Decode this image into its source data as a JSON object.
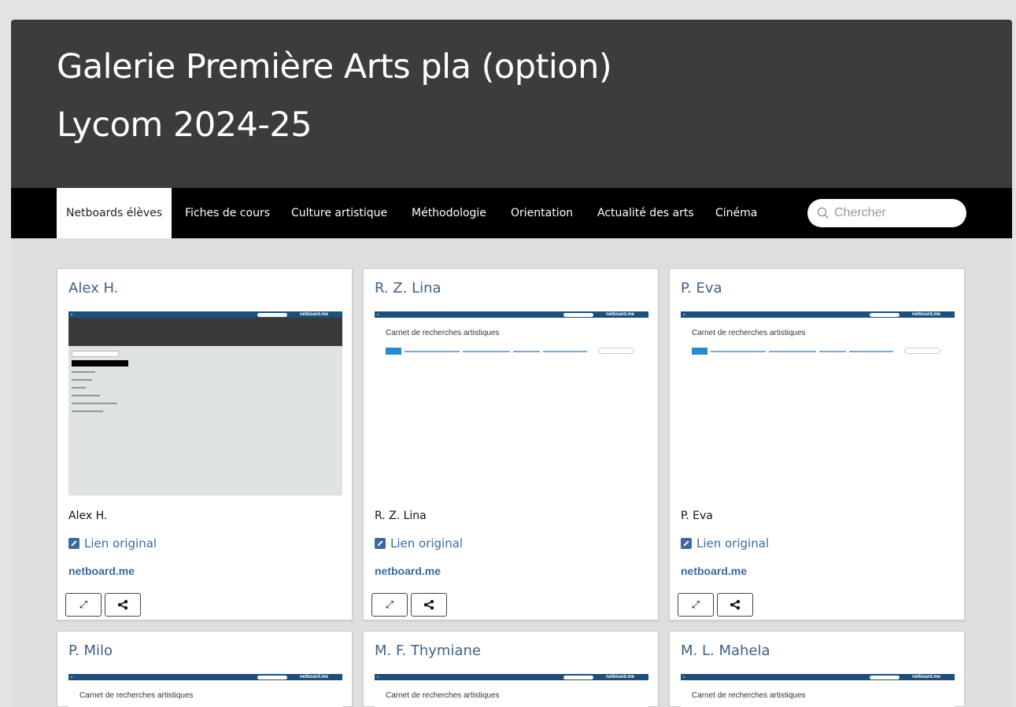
{
  "header": {
    "title_line1": "Galerie Première Arts pla (option)",
    "title_line2": "Lycom 2024-25"
  },
  "nav": {
    "items": [
      {
        "label": "Netboards élèves",
        "active": true
      },
      {
        "label": "Fiches de cours"
      },
      {
        "label": "Culture artistique"
      },
      {
        "label": "Méthodologie"
      },
      {
        "label": "Orientation"
      },
      {
        "label": "Actualité des arts"
      },
      {
        "label": "Cinéma"
      }
    ],
    "search_placeholder": "Chercher"
  },
  "cards": [
    {
      "title": "Alex H.",
      "name": "Alex H.",
      "link_label": "Lien original",
      "domain": "netboard.me",
      "thumb_heading": ""
    },
    {
      "title": "R. Z. Lina",
      "name": "R. Z. Lina",
      "link_label": "Lien original",
      "domain": "netboard.me",
      "thumb_heading": "Carnet de recherches artistiques"
    },
    {
      "title": "P. Eva",
      "name": "P. Eva",
      "link_label": "Lien original",
      "domain": "netboard.me",
      "thumb_heading": "Carnet de recherches artistiques"
    }
  ],
  "cards_row2": [
    {
      "title": "P. Milo",
      "thumb_heading": "Carnet de recherches artistiques"
    },
    {
      "title": "M. F. Thymiane",
      "thumb_heading": "Carnet de recherches artistiques"
    },
    {
      "title": "M. L. Mahela",
      "thumb_heading": "Carnet de recherches artistiques"
    }
  ],
  "thumb_brand": "netboard.me",
  "icons": {
    "expand": "expand-icon",
    "share": "share-icon",
    "link": "external-link-icon",
    "search": "search-icon"
  }
}
